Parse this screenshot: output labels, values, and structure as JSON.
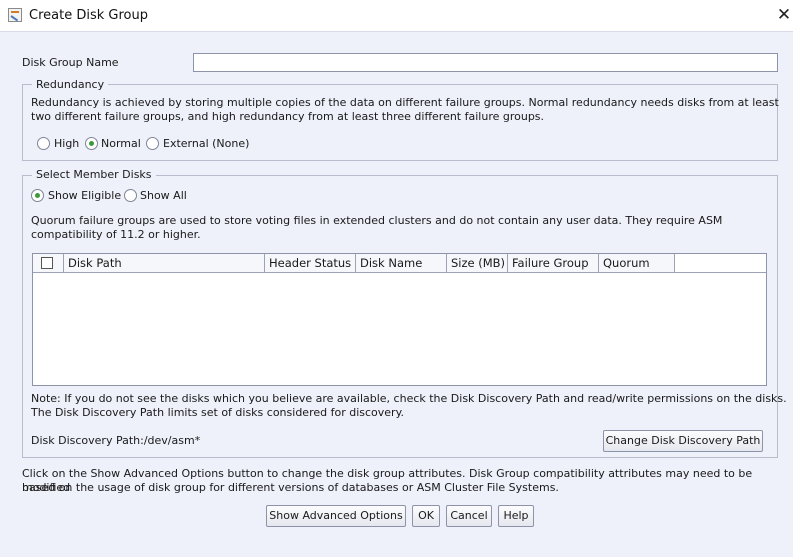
{
  "window": {
    "title": "Create Disk Group",
    "close_glyph": "✕"
  },
  "disk_group_name": {
    "label": "Disk Group Name",
    "value": "",
    "placeholder": ""
  },
  "redundancy": {
    "group_title": "Redundancy",
    "description_line1": "Redundancy is achieved by storing multiple copies of the data on different failure groups. Normal redundancy needs disks from at least",
    "description_line2": "two different failure groups, and high redundancy from at least three different failure groups.",
    "options": [
      {
        "label": "High",
        "checked": false
      },
      {
        "label": "Normal",
        "checked": true
      },
      {
        "label": "External (None)",
        "checked": false
      }
    ]
  },
  "member_disks": {
    "group_title": "Select Member Disks",
    "options": [
      {
        "label": "Show Eligible",
        "checked": true
      },
      {
        "label": "Show All",
        "checked": false
      }
    ],
    "quorum_note_line1": "Quorum failure groups are used to store voting files in extended clusters and do not contain any user data. They require ASM",
    "quorum_note_line2": "compatibility of 11.2 or higher.",
    "table": {
      "columns": [
        "Disk Path",
        "Header Status",
        "Disk Name",
        "Size (MB)",
        "Failure Group",
        "Quorum"
      ],
      "rows": []
    },
    "discovery_note_line1": "Note: If you do not see the disks which you believe are available, check the Disk Discovery Path and read/write permissions on the disks.",
    "discovery_note_line2": "The Disk Discovery Path limits set of disks considered for discovery.",
    "discovery_path_label": "Disk Discovery Path:/dev/asm*",
    "change_path_button": "Change Disk Discovery Path"
  },
  "footer": {
    "note_line1": "Click on the Show Advanced Options button to change the disk group attributes. Disk Group compatibility attributes may need to be modified",
    "note_line2": "based on the usage of disk group for different versions of databases or ASM Cluster File Systems.",
    "buttons": {
      "advanced": "Show Advanced Options",
      "ok": "OK",
      "cancel": "Cancel",
      "help": "Help"
    }
  },
  "colors": {
    "background": "#eef0fa",
    "radio_selected": "#3c9a3c"
  }
}
